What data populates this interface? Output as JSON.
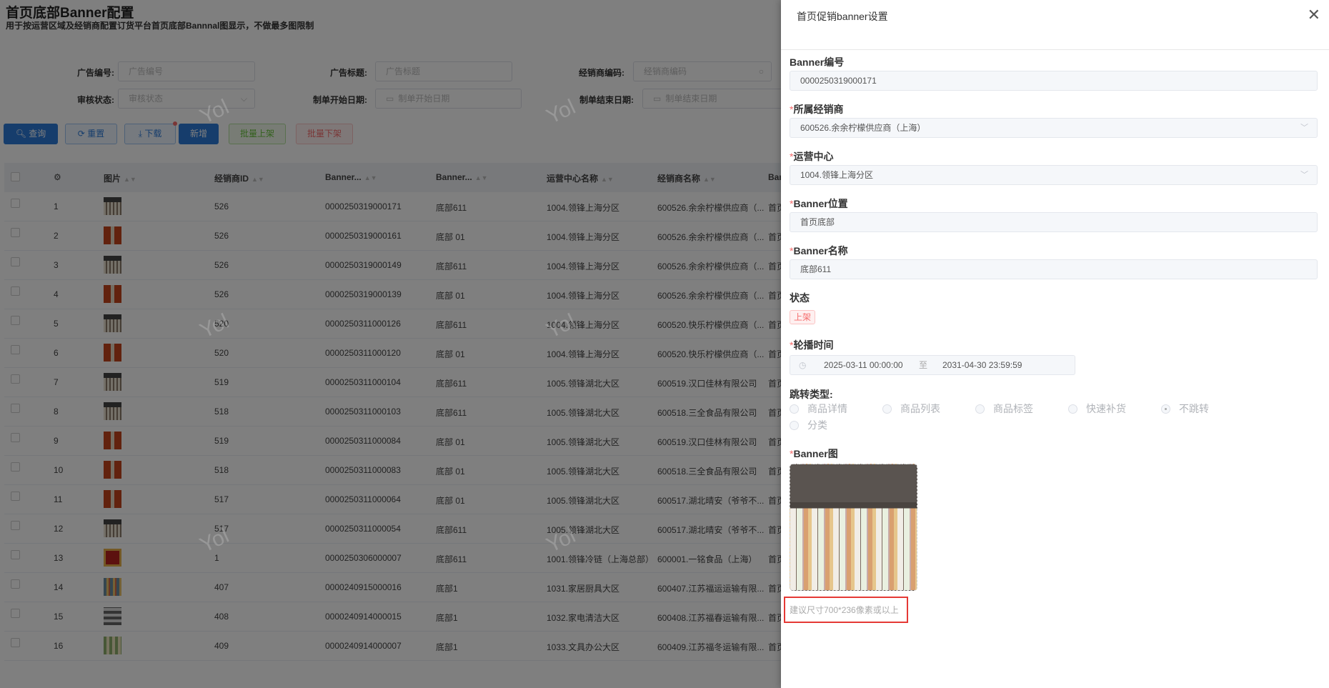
{
  "page": {
    "title": "首页底部Banner配置",
    "subtitle": "用于按运营区域及经销商配置订货平台首页底部Bannnal图显示，不做最多图限制"
  },
  "filters": {
    "ad_no": {
      "label": "广告编号:",
      "placeholder": "广告编号"
    },
    "ad_title": {
      "label": "广告标题:",
      "placeholder": "广告标题"
    },
    "dealer_code": {
      "label": "经销商编码:",
      "placeholder": "经销商编码"
    },
    "audit_status": {
      "label": "审核状态:",
      "placeholder": "审核状态"
    },
    "start_date": {
      "label": "制单开始日期:",
      "placeholder": "制单开始日期"
    },
    "end_date": {
      "label": "制单结束日期:",
      "placeholder": "制单结束日期"
    }
  },
  "toolbar": {
    "query": "查询",
    "reset": "重置",
    "download": "下载",
    "add": "新增",
    "batch_on": "批量上架",
    "batch_off": "批量下架"
  },
  "table": {
    "headers": [
      "图片",
      "经销商ID",
      "Banner...",
      "Banner...",
      "运营中心名称",
      "经销商名称",
      "Ban"
    ],
    "rows": [
      {
        "idx": "1",
        "img": "bottles",
        "dealer_id": "526",
        "banner_no": "0000250319000171",
        "banner_name": "底部611",
        "center": "1004.领锋上海分区",
        "dealer": "600526.余余柠檬供应商（...",
        "pos": "首页底部"
      },
      {
        "idx": "2",
        "img": "orange",
        "dealer_id": "526",
        "banner_no": "0000250319000161",
        "banner_name": "底部 01",
        "center": "1004.领锋上海分区",
        "dealer": "600526.余余柠檬供应商（...",
        "pos": "首页底部"
      },
      {
        "idx": "3",
        "img": "bottles",
        "dealer_id": "526",
        "banner_no": "0000250319000149",
        "banner_name": "底部611",
        "center": "1004.领锋上海分区",
        "dealer": "600526.余余柠檬供应商（...",
        "pos": "首页底部"
      },
      {
        "idx": "4",
        "img": "orange",
        "dealer_id": "526",
        "banner_no": "0000250319000139",
        "banner_name": "底部 01",
        "center": "1004.领锋上海分区",
        "dealer": "600526.余余柠檬供应商（...",
        "pos": "首页底部"
      },
      {
        "idx": "5",
        "img": "bottles",
        "dealer_id": "520",
        "banner_no": "0000250311000126",
        "banner_name": "底部611",
        "center": "1004.领锋上海分区",
        "dealer": "600520.快乐柠檬供应商（...",
        "pos": "首页底部"
      },
      {
        "idx": "6",
        "img": "orange",
        "dealer_id": "520",
        "banner_no": "0000250311000120",
        "banner_name": "底部 01",
        "center": "1004.领锋上海分区",
        "dealer": "600520.快乐柠檬供应商（...",
        "pos": "首页底部"
      },
      {
        "idx": "7",
        "img": "bottles",
        "dealer_id": "519",
        "banner_no": "0000250311000104",
        "banner_name": "底部611",
        "center": "1005.领锋湖北大区",
        "dealer": "600519.汉口佳林有限公司",
        "pos": "首页底部"
      },
      {
        "idx": "8",
        "img": "bottles",
        "dealer_id": "518",
        "banner_no": "0000250311000103",
        "banner_name": "底部611",
        "center": "1005.领锋湖北大区",
        "dealer": "600518.三全食品有限公司",
        "pos": "首页底部"
      },
      {
        "idx": "9",
        "img": "orange",
        "dealer_id": "519",
        "banner_no": "0000250311000084",
        "banner_name": "底部 01",
        "center": "1005.领锋湖北大区",
        "dealer": "600519.汉口佳林有限公司",
        "pos": "首页底部"
      },
      {
        "idx": "10",
        "img": "orange",
        "dealer_id": "518",
        "banner_no": "0000250311000083",
        "banner_name": "底部 01",
        "center": "1005.领锋湖北大区",
        "dealer": "600518.三全食品有限公司",
        "pos": "首页底部"
      },
      {
        "idx": "11",
        "img": "orange",
        "dealer_id": "517",
        "banner_no": "0000250311000064",
        "banner_name": "底部 01",
        "center": "1005.领锋湖北大区",
        "dealer": "600517.湖北晴安（爷爷不...",
        "pos": "首页底部"
      },
      {
        "idx": "12",
        "img": "bottles",
        "dealer_id": "517",
        "banner_no": "0000250311000054",
        "banner_name": "底部611",
        "center": "1005.领锋湖北大区",
        "dealer": "600517.湖北晴安（爷爷不...",
        "pos": "首页底部"
      },
      {
        "idx": "13",
        "img": "red",
        "dealer_id": "1",
        "banner_no": "0000250306000007",
        "banner_name": "底部611",
        "center": "1001.领锋冷链（上海总部）",
        "dealer": "600001.一铭食品（上海）",
        "pos": "首页底部"
      },
      {
        "idx": "14",
        "img": "shelf",
        "dealer_id": "407",
        "banner_no": "0000240915000016",
        "banner_name": "底部1",
        "center": "1031.家居厨具大区",
        "dealer": "600407.江苏福运运输有限...",
        "pos": "首页底部"
      },
      {
        "idx": "15",
        "img": "appliance",
        "dealer_id": "408",
        "banner_no": "0000240914000015",
        "banner_name": "底部1",
        "center": "1032.家电清洁大区",
        "dealer": "600408.江苏福春运输有限...",
        "pos": "首页底部"
      },
      {
        "idx": "16",
        "img": "office",
        "dealer_id": "409",
        "banner_no": "0000240914000007",
        "banner_name": "底部1",
        "center": "1033.文具办公大区",
        "dealer": "600409.江苏福冬运输有限...",
        "pos": "首页底部"
      }
    ]
  },
  "drawer": {
    "title": "首页促销banner设置",
    "fields": {
      "banner_no": {
        "label": "Banner编号",
        "value": "0000250319000171"
      },
      "dealer": {
        "label": "所属经销商",
        "value": "600526.余余柠檬供应商（上海）"
      },
      "center": {
        "label": "运营中心",
        "value": "1004.领锋上海分区"
      },
      "position": {
        "label": "Banner位置",
        "value": "首页底部"
      },
      "name": {
        "label": "Banner名称",
        "value": "底部611"
      },
      "status": {
        "label": "状态",
        "value": "上架"
      },
      "time": {
        "label": "轮播时间",
        "start": "2025-03-11 00:00:00",
        "sep": "至",
        "end": "2031-04-30 23:59:59"
      },
      "jump": {
        "label": "跳转类型:",
        "options": [
          "商品详情",
          "商品列表",
          "商品标签",
          "快速补货",
          "不跳转",
          "分类"
        ],
        "selected": "不跳转"
      },
      "image": {
        "label": "Banner图",
        "hint": "建议尺寸700*236像素或以上"
      }
    }
  },
  "watermark": "Yol",
  "colors": {
    "primary": "#2d7bd9",
    "success": "#67c23a",
    "danger": "#f56c6c"
  }
}
